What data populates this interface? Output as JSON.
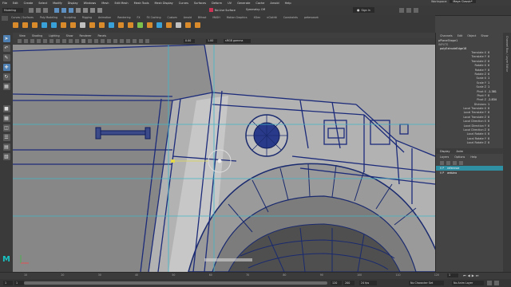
{
  "menubar": {
    "items": [
      "File",
      "Edit",
      "Create",
      "Select",
      "Modify",
      "Display",
      "Windows",
      "Mesh",
      "Edit Mesh",
      "Mesh Tools",
      "Mesh Display",
      "Curves",
      "Surfaces",
      "Deform",
      "UV",
      "Generate",
      "Cache",
      "Arnold",
      "Help"
    ],
    "workspace_label": "Workspace:",
    "workspace_value": "Maya Classic*"
  },
  "statusline": {
    "mode": "Modeling",
    "live_surface": "No Live Surface",
    "symmetry": "Symmetry: Off",
    "sign_in": "Sign In"
  },
  "shelf": {
    "tabs": [
      "Curves / Surfaces",
      "Poly Modeling",
      "Sculpting",
      "Rigging",
      "Animation",
      "Rendering",
      "FX",
      "FX Caching",
      "Custom",
      "Arnold",
      "Bifrost",
      "MASH",
      "Motion Graphics",
      "XGen",
      "nClothIt",
      "Constraints",
      "peterswork"
    ],
    "icon_colors": [
      "#d98b2b",
      "#d98b2b",
      "#d98b2b",
      "#3aa0d8",
      "#3aa0d8",
      "#d98b2b",
      "#d98b2b",
      "#c0c0c0",
      "#d98b2b",
      "#d98b2b",
      "#3aa0d8",
      "#d98b2b",
      "#d98b2b",
      "#7cc14b",
      "#d98b2b",
      "#3aa0d8",
      "#d98b2b",
      "#c0c0c0",
      "#d98b2b",
      "#d98b2b"
    ]
  },
  "panel": {
    "menus": [
      "View",
      "Shading",
      "Lighting",
      "Show",
      "Renderer",
      "Panels"
    ],
    "field_a": "0.00",
    "field_b": "1.00",
    "color_space": "sRGB gamma"
  },
  "channelbox": {
    "tabs": [
      "Channels",
      "Edit",
      "Object",
      "Show"
    ],
    "shape_node": "pPlaneShape1",
    "inputs_label": "INPUTS",
    "input_node": "polyExtrudeEdge18",
    "attributes": [
      {
        "name": "Translate X",
        "value": "0"
      },
      {
        "name": "Translate Y",
        "value": "0"
      },
      {
        "name": "Translate Z",
        "value": "0"
      },
      {
        "name": "Rotate X",
        "value": "0"
      },
      {
        "name": "Rotate Y",
        "value": "0"
      },
      {
        "name": "Rotate Z",
        "value": "0"
      },
      {
        "name": "Scale X",
        "value": "1"
      },
      {
        "name": "Scale Y",
        "value": "1"
      },
      {
        "name": "Scale Z",
        "value": "1"
      },
      {
        "name": "Pivot X",
        "value": "-1.381"
      },
      {
        "name": "Pivot Y",
        "value": "0"
      },
      {
        "name": "Pivot Z",
        "value": "-2.834"
      },
      {
        "name": "Divisions",
        "value": "1"
      },
      {
        "name": "Local Translate X",
        "value": "0"
      },
      {
        "name": "Local Translate Y",
        "value": "0"
      },
      {
        "name": "Local Translate Z",
        "value": "0"
      },
      {
        "name": "Local Direction X",
        "value": "0"
      },
      {
        "name": "Local Direction Y",
        "value": "0"
      },
      {
        "name": "Local Direction Z",
        "value": "0"
      },
      {
        "name": "Local Rotate X",
        "value": "0"
      },
      {
        "name": "Local Rotate Y",
        "value": "0"
      },
      {
        "name": "Local Rotate Z",
        "value": "0"
      }
    ]
  },
  "layers": {
    "tabs": [
      "Display",
      "Anim"
    ],
    "menus": [
      "Layers",
      "Options",
      "Help"
    ],
    "items": [
      {
        "flags": "V  P",
        "name": "reference",
        "selected": true
      },
      {
        "flags": "V  P",
        "name": "arduino",
        "selected": false
      }
    ]
  },
  "timeline": {
    "start": "1",
    "range_start": "1",
    "range_end": "120",
    "end": "200",
    "current": "1",
    "fps": "24 fps",
    "character_set": "No Character Set",
    "anim_layer": "No Anim Layer",
    "ticks": [
      "10",
      "20",
      "30",
      "40",
      "50",
      "60",
      "70",
      "80",
      "90",
      "100",
      "110",
      "120"
    ]
  },
  "viewport": {
    "logo": "M"
  }
}
